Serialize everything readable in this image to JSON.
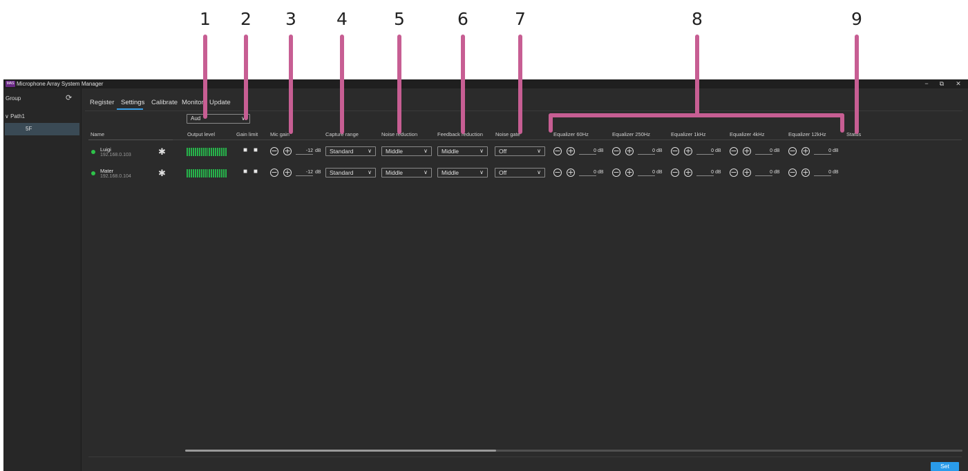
{
  "callouts": [
    "1",
    "2",
    "3",
    "4",
    "5",
    "6",
    "7",
    "8",
    "9"
  ],
  "window": {
    "logo_text": "MAS",
    "title": "Microphone Array System Manager",
    "minimize": "−",
    "restore": "⧉",
    "close": "✕"
  },
  "sidebar": {
    "group_label": "Group",
    "refresh_glyph": "⟳",
    "path_chevron": "∨",
    "path_label": "Path1",
    "selected_item": "5F"
  },
  "tabs": [
    "Register",
    "Settings",
    "Calibrate",
    "Monitor",
    "Update"
  ],
  "active_tab": "Settings",
  "view_select": {
    "value": "Aud",
    "chevron": "∨"
  },
  "columns": {
    "name": "Name",
    "output_level": "Output level",
    "gain_limit": "Gain limit",
    "mic_gain": "Mic gain",
    "capture_range": "Capture range",
    "noise_reduction": "Noise reduction",
    "feedback_reduction": "Feedback reduction",
    "noise_gate": "Noise gate",
    "eq_60": "Equalizer 60Hz",
    "eq_250": "Equalizer 250Hz",
    "eq_1k": "Equalizer 1kHz",
    "eq_4k": "Equalizer 4kHz",
    "eq_12k": "Equalizer 12kHz",
    "status": "Status"
  },
  "devices": [
    {
      "name": "Luigi",
      "ip": "192.168.0.103",
      "gain_limit": "■ ■",
      "mic_gain": "-12",
      "capture_range": "Standard",
      "noise_reduction": "Middle",
      "feedback_reduction": "Middle",
      "noise_gate": "Off",
      "eq": [
        "0",
        "0",
        "0",
        "0",
        "0"
      ]
    },
    {
      "name": "Mater",
      "ip": "192.168.0.104",
      "gain_limit": "■ ■",
      "mic_gain": "-12",
      "capture_range": "Standard",
      "noise_reduction": "Middle",
      "feedback_reduction": "Middle",
      "noise_gate": "Off",
      "eq": [
        "0",
        "0",
        "0",
        "0",
        "0"
      ]
    }
  ],
  "glyphs": {
    "minus": "−",
    "plus": "+",
    "gear": "✱",
    "chevron": "∨",
    "db": "dB"
  },
  "set_button": "Set",
  "colors": {
    "accent": "#2a9bea",
    "status_online": "#2ec24a",
    "meter": "#27b34b",
    "callout": "#c75e93"
  }
}
